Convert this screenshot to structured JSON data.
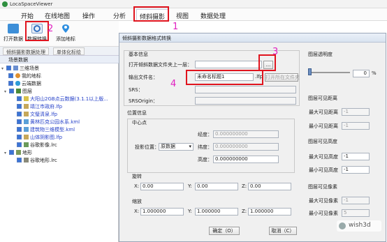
{
  "app": {
    "title": "LocaSpaceViewer"
  },
  "menu": [
    "开始",
    "在线地图",
    "操作",
    "分析",
    "倾斜摄影",
    "视图",
    "数据处理"
  ],
  "ribbon": {
    "buttons": [
      "打开数据",
      "数据转换",
      "添加地标"
    ]
  },
  "subtabs": [
    "倾斜摄影数据处理",
    "单体化标绘"
  ],
  "panel": {
    "header": "场景数据",
    "tree": [
      "三维场景",
      "我的地标",
      "云端数据",
      "图层",
      "大阳山2GB点云数据(3.1.1以上版...",
      "靖江市政府.lfp",
      "文璧清泉.lfp",
      "黄林匹克公园水系.kml",
      "建筑物三维模型.kml",
      "山体阴影图.lfp",
      "谷歌影像.lrc",
      "地形",
      "谷歌地形.lrc"
    ]
  },
  "annotations": [
    "1",
    "2",
    "3",
    "4"
  ],
  "dialog": {
    "title": "倾斜摄影数据格式转换",
    "basic_title": "基本信息",
    "open_label": "打开倾斜数据文件夹上一层：",
    "open_value": "",
    "browse": "...",
    "output_label": "输出文件名：",
    "output_value": "未命名标题1",
    "ext": ".lfp",
    "open_folder": "打开所在文件夹",
    "srs_label": "SRS：",
    "srsorigin_label": "SRSOrigin：",
    "pos_title": "位置信息",
    "center_title": "中心点",
    "lon_label": "经度：",
    "lon_value": "0.000000000",
    "proj_label": "投影位置：",
    "proj_value": "原数据",
    "lat_label": "纬度：",
    "lat_value": "0.000000000",
    "height_label": "高度：",
    "height_value": "0.000000000",
    "rotate_title": "旋转",
    "rx_label": "X:",
    "rx": "0.00",
    "ry_label": "Y:",
    "ry": "0.00",
    "rz_label": "Z:",
    "rz": "0.00",
    "scale_title": "缩放",
    "sx_label": "X:",
    "sx": "1.000000",
    "sy_label": "Y:",
    "sy": "1.000000",
    "sz_label": "Z:",
    "sz": "1.000000",
    "ok": "确定（O）",
    "cancel": "取消（C）",
    "right": {
      "opacity_title": "图层透明度",
      "opacity_value": "0",
      "opacity_unit": "%",
      "vis_dist_title": "图层可见距离",
      "max_dist_label": "最大可见距离",
      "max_dist": "-1",
      "min_dist_label": "最小可见距离",
      "min_dist": "-1",
      "vis_height_title": "图层可见高度",
      "max_h_label": "最大可见高度",
      "max_h": "-1",
      "min_h_label": "最小可见高度",
      "min_h": "-1",
      "vis_px_title": "图层可见像素",
      "max_px_label": "最大可见像素",
      "max_px": "-1",
      "min_px_label": "最小可见像素",
      "min_px": "5"
    }
  },
  "watermark": "wish3d",
  "colors": {
    "highlight_red": "#e0141e",
    "annotation_magenta": "#e020c0",
    "tree_blue": "#2540c8"
  }
}
